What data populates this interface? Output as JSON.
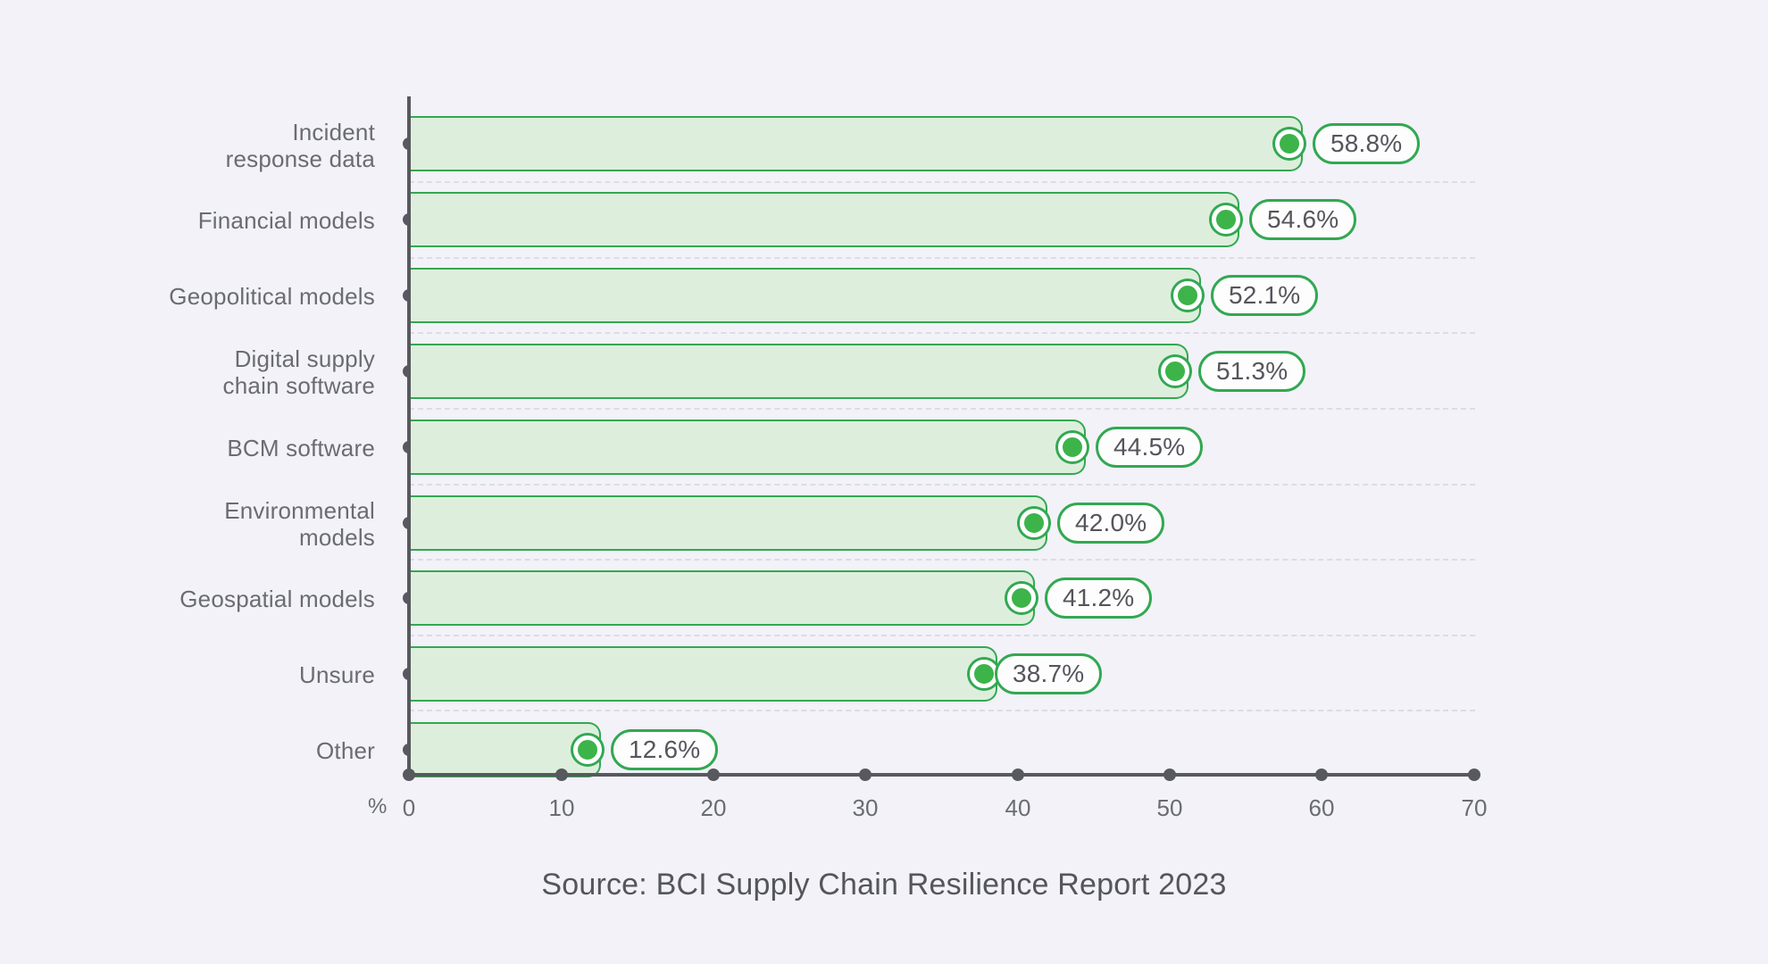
{
  "chart_data": {
    "type": "bar",
    "orientation": "horizontal",
    "title": "",
    "xlabel": "%",
    "ylabel": "",
    "xlim": [
      0,
      70
    ],
    "xticks": [
      0,
      10,
      20,
      30,
      40,
      50,
      60,
      70
    ],
    "grid": true,
    "legend": null,
    "categories": [
      "Incident response data",
      "Financial models",
      "Geopolitical models",
      "Digital supply chain software",
      "BCM software",
      "Environmental models",
      "Geospatial models",
      "Unsure",
      "Other"
    ],
    "values": [
      58.8,
      54.6,
      52.1,
      51.3,
      44.5,
      42.0,
      41.2,
      38.7,
      12.6
    ],
    "value_labels": [
      "58.8%",
      "54.6%",
      "52.1%",
      "51.3%",
      "44.5%",
      "42.0%",
      "41.2%",
      "38.7%",
      "12.6%"
    ],
    "colors": {
      "bar_fill": "#ddefdc",
      "bar_stroke": "#32a852",
      "marker_fill": "#3cb44a",
      "axis": "#58585f",
      "grid": "#dcdce4",
      "background": "#f2f2f8",
      "label_text": "#6b6b73",
      "value_text": "#55555c"
    }
  },
  "axis": {
    "unit_label": "%",
    "tick_labels": [
      "0",
      "10",
      "20",
      "30",
      "40",
      "50",
      "60",
      "70"
    ]
  },
  "categories": [
    {
      "label_line1": "Incident",
      "label_line2": "response data"
    },
    {
      "label_line1": "Financial models",
      "label_line2": ""
    },
    {
      "label_line1": "Geopolitical models",
      "label_line2": ""
    },
    {
      "label_line1": "Digital supply",
      "label_line2": "chain software"
    },
    {
      "label_line1": "BCM software",
      "label_line2": ""
    },
    {
      "label_line1": "Environmental",
      "label_line2": "models"
    },
    {
      "label_line1": "Geospatial models",
      "label_line2": ""
    },
    {
      "label_line1": "Unsure",
      "label_line2": ""
    },
    {
      "label_line1": "Other",
      "label_line2": ""
    }
  ],
  "footer": {
    "source": "Source: BCI Supply Chain Resilience Report 2023"
  }
}
